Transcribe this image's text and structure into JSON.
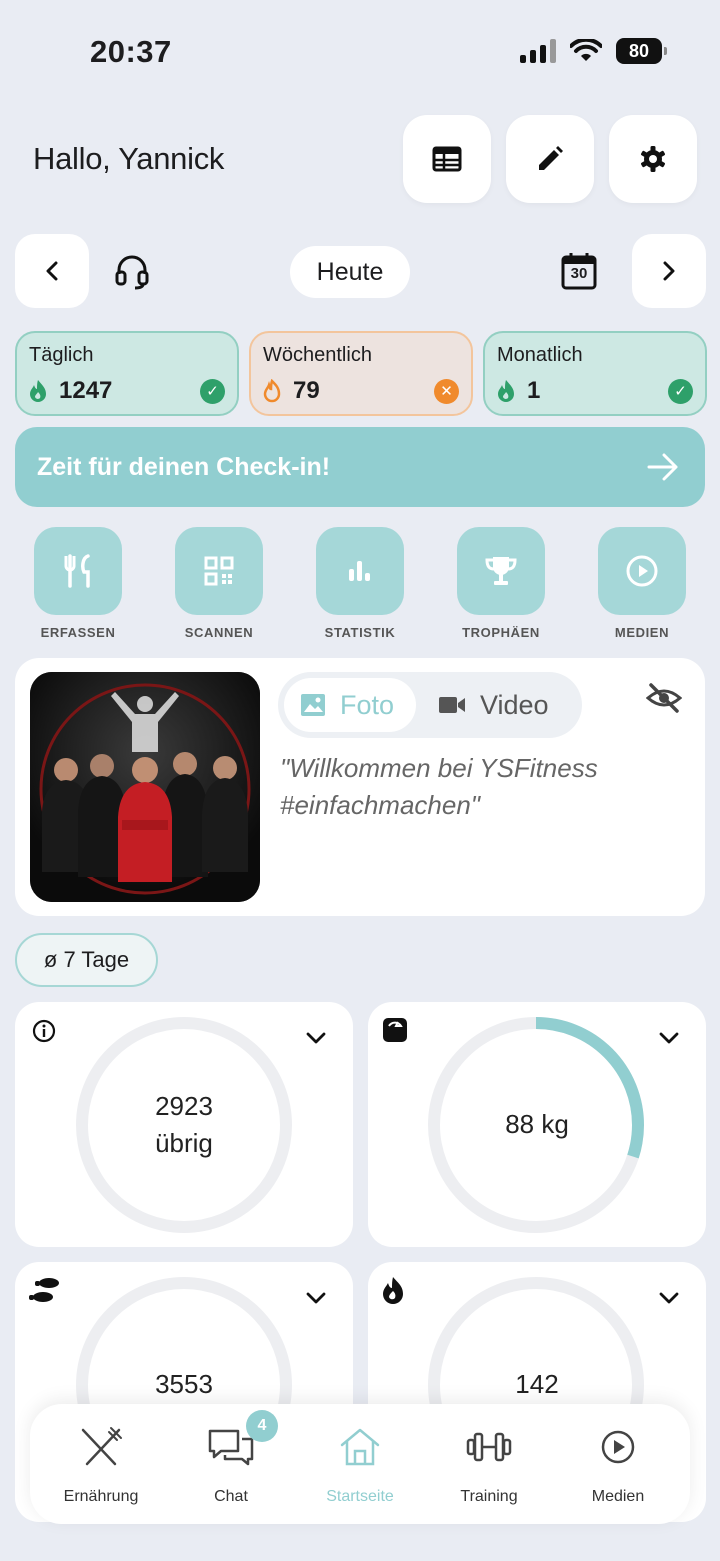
{
  "status_bar": {
    "time": "20:37",
    "battery": "80"
  },
  "header": {
    "greeting": "Hallo, Yannick"
  },
  "date_nav": {
    "today_label": "Heute",
    "calendar_day": "30"
  },
  "streaks": [
    {
      "label": "Täglich",
      "value": "1247",
      "status": "ok"
    },
    {
      "label": "Wöchentlich",
      "value": "79",
      "status": "missed"
    },
    {
      "label": "Monatlich",
      "value": "1",
      "status": "ok"
    }
  ],
  "checkin": {
    "label": "Zeit für deinen Check-in!"
  },
  "quick_actions": [
    {
      "label": "ERFASSEN",
      "icon": "fork-knife-icon"
    },
    {
      "label": "SCANNEN",
      "icon": "qr-code-icon"
    },
    {
      "label": "STATISTIK",
      "icon": "bar-chart-icon"
    },
    {
      "label": "TROPHÄEN",
      "icon": "trophy-icon"
    },
    {
      "label": "MEDIEN",
      "icon": "play-circle-icon"
    }
  ],
  "welcome": {
    "tab_photo": "Foto",
    "tab_video": "Video",
    "quote": "\"Willkommen bei YSFitness #einfachmachen\""
  },
  "average_filter": "ø 7 Tage",
  "metrics": [
    {
      "icon": "info-icon",
      "value": "2923",
      "sub": "übrig",
      "progress": 0
    },
    {
      "icon": "scale-icon",
      "value": "88 kg",
      "sub": "",
      "progress": 0.3
    },
    {
      "icon": "footsteps-icon",
      "value": "3553",
      "sub": "",
      "progress": 0
    },
    {
      "icon": "flame-icon",
      "value": "142",
      "sub": "",
      "progress": 0
    }
  ],
  "bottom_nav": {
    "items": [
      "Ernährung",
      "Chat",
      "Startseite",
      "Training",
      "Medien"
    ],
    "active": "Startseite",
    "chat_badge": "4"
  },
  "colors": {
    "accent": "#91ced0",
    "background": "#e9ecf3",
    "streak_ok": "#2ea06a",
    "streak_warn": "#f08a2c"
  }
}
